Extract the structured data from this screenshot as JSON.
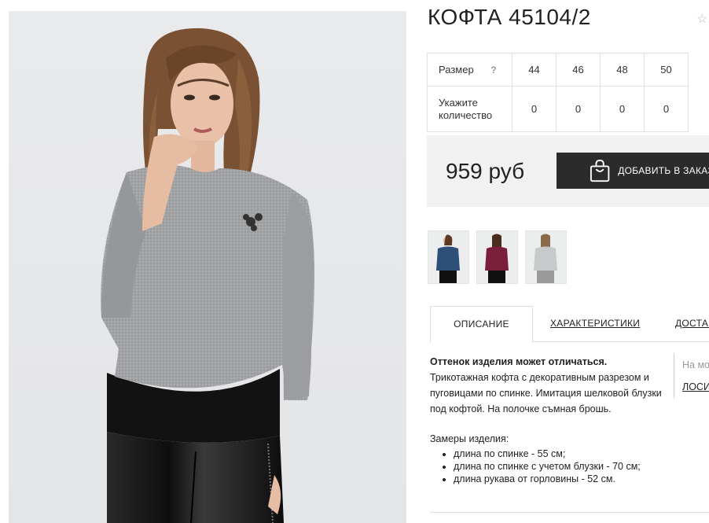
{
  "product": {
    "title": "КОФТА 45104/2",
    "favorite_icon": "star-outline-icon"
  },
  "sizes": {
    "size_label": "Размер",
    "help_glyph": "?",
    "values": [
      "44",
      "46",
      "48",
      "50"
    ],
    "qty_label": "Укажите количество",
    "qty_values": [
      "0",
      "0",
      "0",
      "0"
    ]
  },
  "price": {
    "amount": "959 руб",
    "add_to_cart": "ДОБАВИТЬ В ЗАКАЗ",
    "cart_icon": "shopping-bag-icon"
  },
  "thumbnails": [
    {
      "color": "#2e4f78",
      "name": "navy"
    },
    {
      "color": "#7b1e3a",
      "name": "burgundy"
    },
    {
      "color": "#c8c9cb",
      "name": "grey"
    }
  ],
  "tabs": [
    "ОПИСАНИЕ",
    "ХАРАКТЕРИСТИКИ",
    "ДОСТАВКА"
  ],
  "description": {
    "note": "Оттенок изделия может отличаться.",
    "text": "Трикотажная кофта с декоративным разрезом и пуговицами по спинке. Имитация шелковой блузки под кофтой. На полочке съмная брошь."
  },
  "side_note": {
    "line1": "На мо",
    "line2": "ЛОСИ"
  },
  "measurements": {
    "heading": "Замеры изделия:",
    "items": [
      "длина по спинке - 55 см;",
      "длина по спинке с учетом блузки - 70 см;",
      "длина рукава от горловины - 52 см."
    ]
  },
  "colors": {
    "sweater": "#9a9b9d",
    "blouse": "#111111",
    "leather": "#1a1a1a",
    "button_bg": "#2b2b2b"
  }
}
